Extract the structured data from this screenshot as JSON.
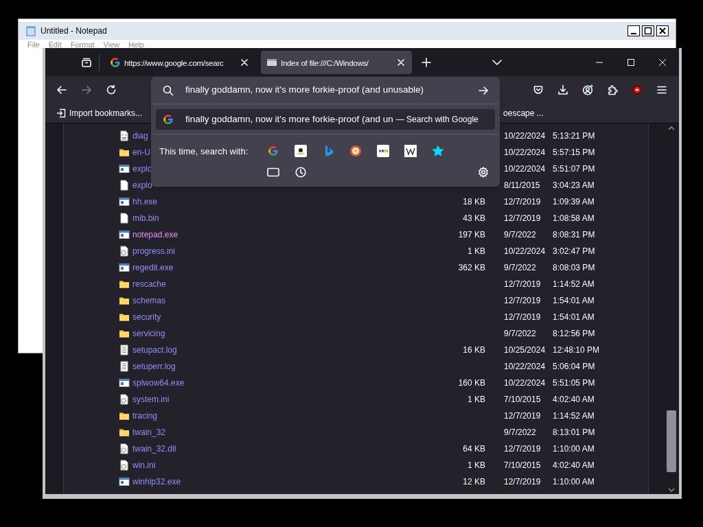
{
  "notepad": {
    "title": "Untitled - Notepad",
    "menu": [
      "File",
      "Edit",
      "Format",
      "View",
      "Help"
    ]
  },
  "browser": {
    "tabs": [
      {
        "title": "https://www.google.com/searc",
        "kind": "google",
        "selected": false
      },
      {
        "title": "Index of file:///C:/Windows/",
        "kind": "file",
        "selected": true
      }
    ],
    "back": {
      "disabled": false
    },
    "forward": {
      "disabled": true
    },
    "urlbar": {
      "value": "finally goddamn, now it's more forkie-proof (and unusable)"
    },
    "suggestions": [
      {
        "text": "finally goddamn, now it's more forkie-proof (and un",
        "action": "— Search with Google",
        "selected": true
      }
    ],
    "search_with_label": "This time, search with:",
    "bookmarks": [
      "Import bookmarks...",
      "oescape ..."
    ],
    "files": [
      {
        "kind": "xml",
        "name": "diag",
        "date": "10/22/2024",
        "time": "5:13:21 PM",
        "visited": false
      },
      {
        "kind": "folder",
        "name": "en-U",
        "date": "10/22/2024",
        "time": "5:57:15 PM",
        "visited": false
      },
      {
        "kind": "exe",
        "name": "explo",
        "date": "10/22/2024",
        "time": "5:51:07 PM",
        "visited": false
      },
      {
        "kind": "file",
        "name": "explo",
        "date": "8/11/2015",
        "time": "3:04:23 AM",
        "visited": false
      },
      {
        "kind": "exe",
        "name": "hh.exe",
        "size": "18 KB",
        "date": "12/7/2019",
        "time": "1:09:39 AM",
        "visited": false
      },
      {
        "kind": "file",
        "name": "mib.bin",
        "size": "43 KB",
        "date": "12/7/2019",
        "time": "1:08:58 AM",
        "visited": false
      },
      {
        "kind": "exe",
        "name": "notepad.exe",
        "size": "197 KB",
        "date": "9/7/2022",
        "time": "8:08:31 PM",
        "visited": true
      },
      {
        "kind": "ini",
        "name": "progress.ini",
        "size": "1 KB",
        "date": "10/22/2024",
        "time": "3:02:47 PM",
        "visited": false
      },
      {
        "kind": "exe",
        "name": "regedit.exe",
        "size": "362 KB",
        "date": "9/7/2022",
        "time": "8:08:03 PM",
        "visited": false
      },
      {
        "kind": "folder",
        "name": "rescache",
        "date": "12/7/2019",
        "time": "1:14:52 AM",
        "visited": false
      },
      {
        "kind": "folder",
        "name": "schemas",
        "date": "12/7/2019",
        "time": "1:54:01 AM",
        "visited": false
      },
      {
        "kind": "folder",
        "name": "security",
        "date": "12/7/2019",
        "time": "1:54:01 AM",
        "visited": false
      },
      {
        "kind": "folder",
        "name": "servicing",
        "date": "9/7/2022",
        "time": "8:12:56 PM",
        "visited": false
      },
      {
        "kind": "log",
        "name": "setupact.log",
        "size": "16 KB",
        "date": "10/25/2024",
        "time": "12:48:10 PM",
        "visited": false
      },
      {
        "kind": "log",
        "name": "setuperr.log",
        "date": "10/22/2024",
        "time": "5:06:04 PM",
        "visited": false
      },
      {
        "kind": "exe",
        "name": "splwow64.exe",
        "size": "160 KB",
        "date": "10/22/2024",
        "time": "5:51:05 PM",
        "visited": false
      },
      {
        "kind": "ini",
        "name": "system.ini",
        "size": "1 KB",
        "date": "7/10/2015",
        "time": "4:02:40 AM",
        "visited": false
      },
      {
        "kind": "folder",
        "name": "tracing",
        "date": "12/7/2019",
        "time": "1:14:52 AM",
        "visited": false
      },
      {
        "kind": "folder",
        "name": "twain_32",
        "date": "9/7/2022",
        "time": "8:13:01 PM",
        "visited": false
      },
      {
        "kind": "ini",
        "name": "twain_32.dll",
        "size": "64 KB",
        "date": "12/7/2019",
        "time": "1:10:00 AM",
        "visited": false
      },
      {
        "kind": "ini",
        "name": "win.ini",
        "size": "1 KB",
        "date": "7/10/2015",
        "time": "4:02:40 AM",
        "visited": false
      },
      {
        "kind": "exe",
        "name": "winhlp32.exe",
        "size": "12 KB",
        "date": "12/7/2019",
        "time": "1:10:00 AM",
        "visited": false
      }
    ]
  }
}
